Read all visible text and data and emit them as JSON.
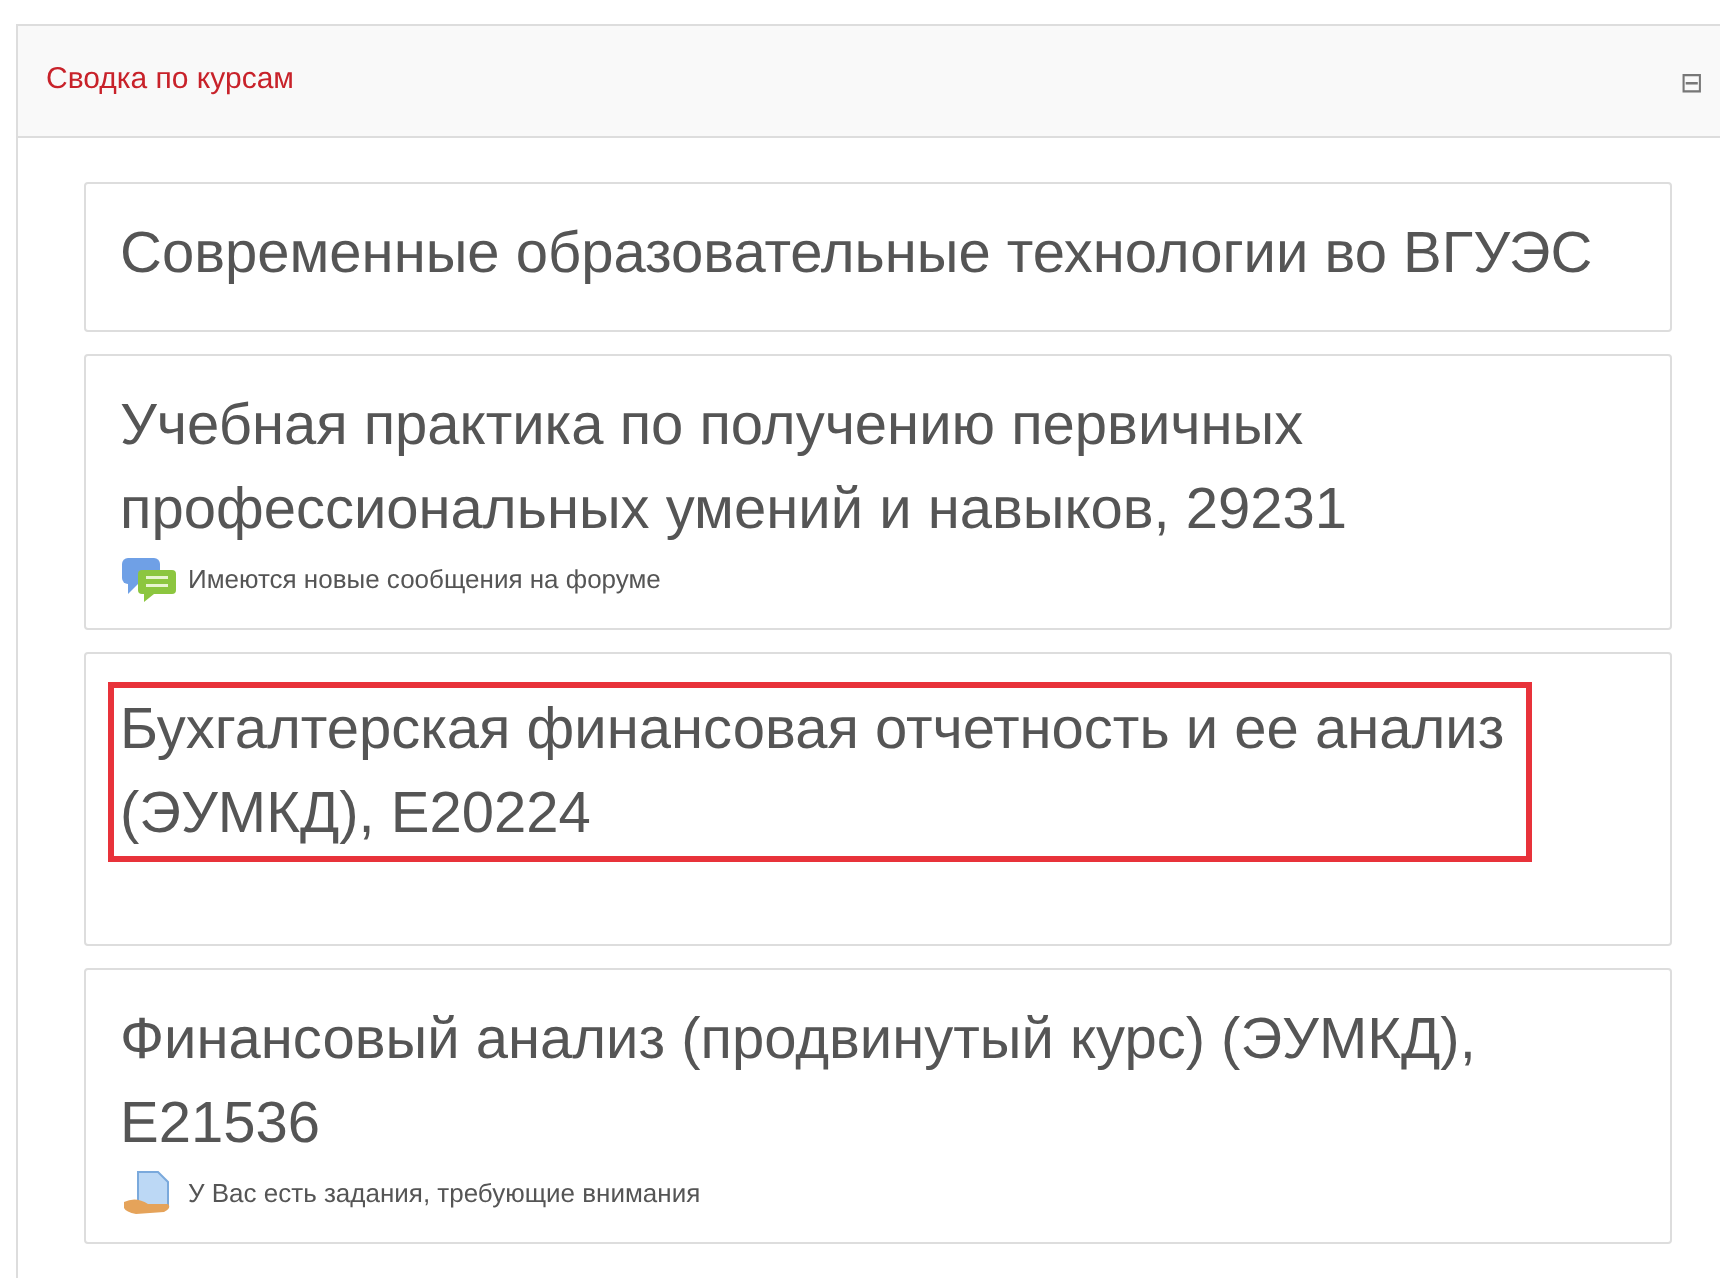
{
  "block": {
    "title": "Сводка по курсам",
    "collapse_icon": "⊟"
  },
  "courses": [
    {
      "title": "Современные образовательные технологии во ВГУЭС",
      "highlighted": false
    },
    {
      "title": "Учебная практика по получению первичных профессиональных умений и навыков, 29231",
      "highlighted": false,
      "notices": [
        {
          "kind": "forum",
          "text": "Имеются новые сообщения на форуме"
        }
      ]
    },
    {
      "title": "Бухгалтерская финансовая отчетность и ее анализ (ЭУМКД), Е20224",
      "highlighted": true
    },
    {
      "title": "Финансовый анализ (продвинутый курс) (ЭУМКД), Е21536",
      "highlighted": false,
      "notices": [
        {
          "kind": "assignment",
          "text": "У Вас есть задания, требующие внимания"
        }
      ]
    }
  ]
}
